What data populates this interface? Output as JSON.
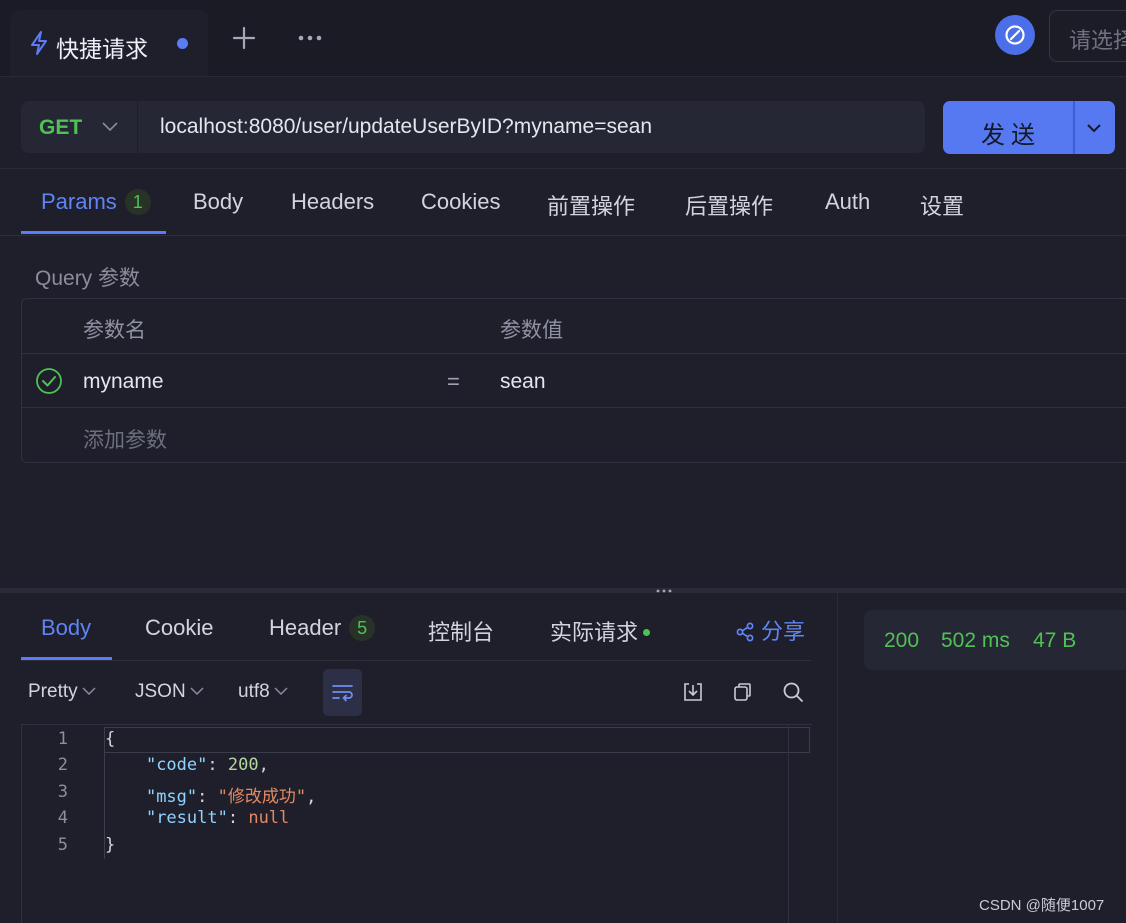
{
  "tabs": {
    "active_title": "快捷请求",
    "active_icon": "lightning-icon",
    "add_icon": "plus-icon",
    "more_icon": "more-dots-icon"
  },
  "environment": {
    "icon": "environment-switch-icon",
    "placeholder": "请选择"
  },
  "request": {
    "method": "GET",
    "url": "localhost:8080/user/updateUserByID?myname=sean",
    "send_label": "发送"
  },
  "request_tabs": [
    {
      "label": "Params",
      "badge": "1"
    },
    {
      "label": "Body"
    },
    {
      "label": "Headers"
    },
    {
      "label": "Cookies"
    },
    {
      "label": "前置操作"
    },
    {
      "label": "后置操作"
    },
    {
      "label": "Auth"
    },
    {
      "label": "设置"
    }
  ],
  "query": {
    "title": "Query 参数",
    "col_name": "参数名",
    "col_value": "参数值",
    "rows": [
      {
        "name": "myname",
        "eq": "=",
        "value": "sean"
      }
    ],
    "add_placeholder": "添加参数"
  },
  "response_tabs": [
    {
      "label": "Body"
    },
    {
      "label": "Cookie"
    },
    {
      "label": "Header",
      "badge": "5"
    },
    {
      "label": "控制台"
    },
    {
      "label": "实际请求"
    }
  ],
  "share_label": "分享",
  "status": {
    "code": "200",
    "time": "502 ms",
    "size": "47 B"
  },
  "format": {
    "mode": "Pretty",
    "type": "JSON",
    "encoding": "utf8"
  },
  "code_lines": [
    "1",
    "2",
    "3",
    "4",
    "5"
  ],
  "response_body": {
    "open": "{",
    "code_key": "\"code\"",
    "code_val": "200",
    "msg_key": "\"msg\"",
    "msg_val": "\"修改成功\"",
    "result_key": "\"result\"",
    "result_val": "null",
    "close": "}"
  },
  "colors": {
    "accent": "#5b7cf5",
    "success": "#4fc254",
    "background": "#1f1f2b"
  },
  "watermark": "CSDN @随便1007"
}
